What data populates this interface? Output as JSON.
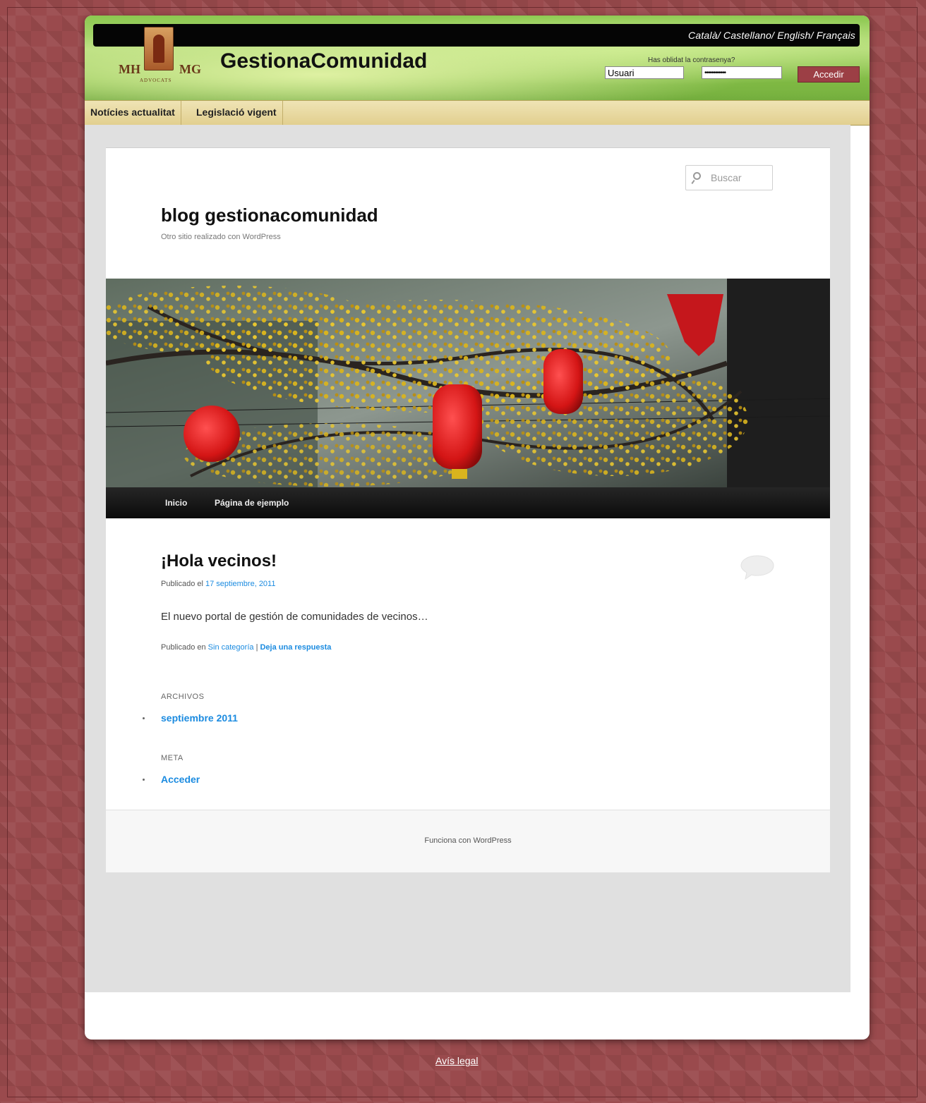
{
  "header": {
    "languages": "Català/ Castellano/ English/ Français",
    "logo_left": "MH",
    "logo_right": "MG",
    "logo_sub": "ADVOCATS",
    "site_title": "GestionaComunidad",
    "forgot_password": "Has oblidat la contrasenya?",
    "username_value": "Usuari",
    "password_value": "••••••••••••",
    "login_button": "Accedir"
  },
  "menu": {
    "items": [
      "Notícies actualitat",
      "Legislació vigent"
    ]
  },
  "blog": {
    "search_placeholder": "Buscar",
    "title": "blog gestionacomunidad",
    "description": "Otro sitio realizado con WordPress",
    "nav": [
      "Inicio",
      "Página de ejemplo"
    ]
  },
  "post": {
    "title": "¡Hola vecinos!",
    "published_label": "Publicado el",
    "date": "17 septiembre, 2011",
    "body": "El nuevo portal de gestión de comunidades de vecinos…",
    "category_label": "Publicado en",
    "category": "Sin categoría",
    "separator": "|",
    "reply": "Deja una respuesta"
  },
  "widgets": {
    "archives_title": "ARCHIVOS",
    "archives_item": "septiembre 2011",
    "meta_title": "META",
    "meta_item": "Acceder"
  },
  "footer": {
    "powered": "Funciona con WordPress"
  },
  "page_footer": {
    "legal": "Avís legal"
  },
  "colors": {
    "background": "#9a4a4d",
    "link": "#1b8be0",
    "login_button": "#9c3f45",
    "menubar": "#e2cf8f"
  }
}
